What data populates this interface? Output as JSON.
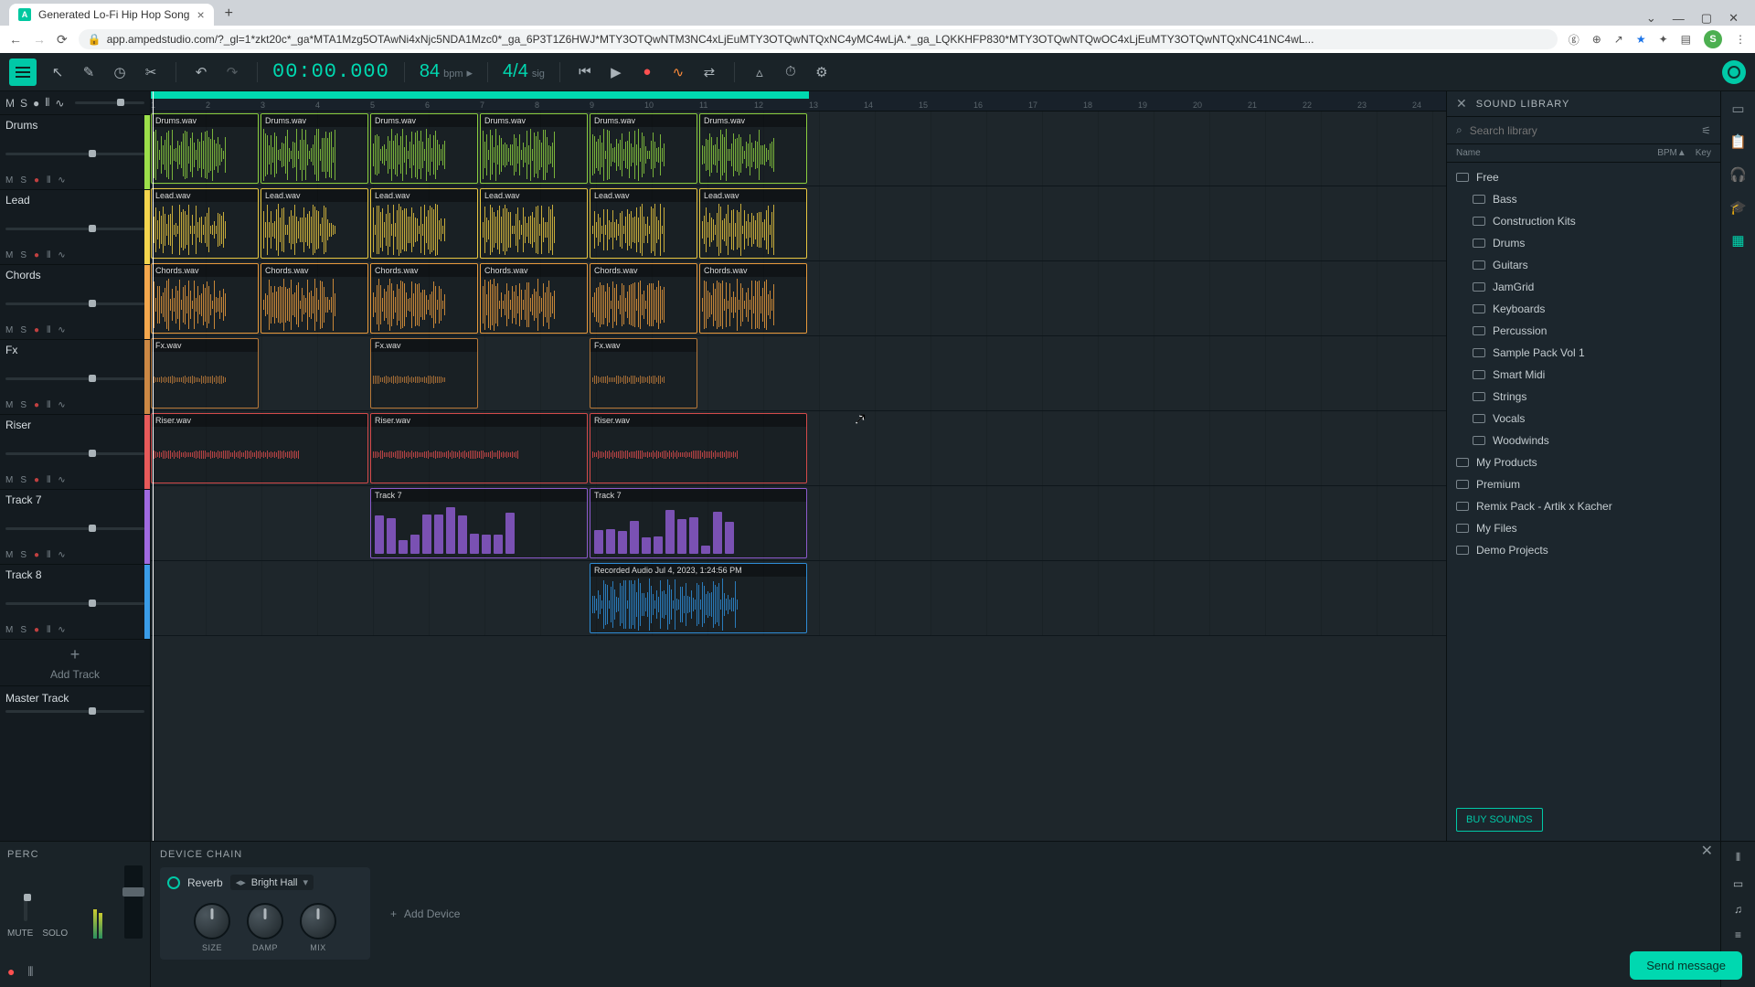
{
  "browser": {
    "tab_title": "Generated Lo-Fi Hip Hop Song",
    "url": "app.ampedstudio.com/?_gl=1*zkt20c*_ga*MTA1Mzg5OTAwNi4xNjc5NDA1Mzc0*_ga_6P3T1Z6HWJ*MTY3OTQwNTM3NC4xLjEuMTY3OTQwNTQxNC4yMC4wLjA.*_ga_LQKKHFP830*MTY3OTQwNTQwOC4xLjEuMTY3OTQwNTQxNC41NC4wL..."
  },
  "transport": {
    "time": "00:00.000",
    "bpm": "84",
    "bpm_label": "bpm",
    "sig": "4/4",
    "sig_label": "sig"
  },
  "ruler_ticks": [
    "1",
    "2",
    "3",
    "4",
    "5",
    "6",
    "7",
    "8",
    "9",
    "10",
    "11",
    "12",
    "13",
    "14",
    "15",
    "16",
    "17",
    "18",
    "19",
    "20",
    "21",
    "22",
    "23",
    "24"
  ],
  "tracks": [
    {
      "name": "Drums",
      "color": "#9ce04a",
      "clip_color": "#8bce3f",
      "clips": [
        {
          "label": "Drums.wav",
          "start": 0,
          "len": 2
        },
        {
          "label": "Drums.wav",
          "start": 2,
          "len": 2
        },
        {
          "label": "Drums.wav",
          "start": 4,
          "len": 2
        },
        {
          "label": "Drums.wav",
          "start": 6,
          "len": 2
        },
        {
          "label": "Drums.wav",
          "start": 8,
          "len": 2
        },
        {
          "label": "Drums.wav",
          "start": 10,
          "len": 2
        }
      ]
    },
    {
      "name": "Lead",
      "color": "#f5d54d",
      "clip_color": "#e8c640",
      "clips": [
        {
          "label": "Lead.wav",
          "start": 0,
          "len": 2
        },
        {
          "label": "Lead.wav",
          "start": 2,
          "len": 2
        },
        {
          "label": "Lead.wav",
          "start": 4,
          "len": 2
        },
        {
          "label": "Lead.wav",
          "start": 6,
          "len": 2
        },
        {
          "label": "Lead.wav",
          "start": 8,
          "len": 2
        },
        {
          "label": "Lead.wav",
          "start": 10,
          "len": 2
        }
      ]
    },
    {
      "name": "Chords",
      "color": "#f5a84d",
      "clip_color": "#e89a3c",
      "clips": [
        {
          "label": "Chords.wav",
          "start": 0,
          "len": 2
        },
        {
          "label": "Chords.wav",
          "start": 2,
          "len": 2
        },
        {
          "label": "Chords.wav",
          "start": 4,
          "len": 2
        },
        {
          "label": "Chords.wav",
          "start": 6,
          "len": 2
        },
        {
          "label": "Chords.wav",
          "start": 8,
          "len": 2
        },
        {
          "label": "Chords.wav",
          "start": 10,
          "len": 2
        }
      ]
    },
    {
      "name": "Fx",
      "color": "#cc8844",
      "clip_color": "#b87838",
      "thin": true,
      "clips": [
        {
          "label": "Fx.wav",
          "start": 0,
          "len": 2
        },
        {
          "label": "Fx.wav",
          "start": 4,
          "len": 2
        },
        {
          "label": "Fx.wav",
          "start": 8,
          "len": 2
        }
      ]
    },
    {
      "name": "Riser",
      "color": "#e85a5a",
      "clip_color": "#d44a4a",
      "thin": true,
      "clips": [
        {
          "label": "Riser.wav",
          "start": 0,
          "len": 4
        },
        {
          "label": "Riser.wav",
          "start": 4,
          "len": 4
        },
        {
          "label": "Riser.wav",
          "start": 8,
          "len": 4
        }
      ]
    },
    {
      "name": "Track 7",
      "color": "#a06ae0",
      "clip_color": "#8c5acc",
      "midi": true,
      "clips": [
        {
          "label": "Track 7",
          "start": 4,
          "len": 4
        },
        {
          "label": "Track 7",
          "start": 8,
          "len": 4
        }
      ]
    },
    {
      "name": "Track 8",
      "color": "#3a9ce8",
      "clip_color": "#2e8cd6",
      "clips": [
        {
          "label": "Recorded Audio Jul 4, 2023, 1:24:56 PM",
          "start": 8,
          "len": 4
        }
      ]
    }
  ],
  "track_buttons": {
    "mute": "M",
    "solo": "S",
    "record_icon": "●"
  },
  "add_track_label": "Add Track",
  "master_track_label": "Master Track",
  "library": {
    "title": "SOUND LIBRARY",
    "search_placeholder": "Search library",
    "cols": {
      "name": "Name",
      "bpm": "BPM▲",
      "key": "Key"
    },
    "items": [
      {
        "label": "Free",
        "sub": false
      },
      {
        "label": "Bass",
        "sub": true
      },
      {
        "label": "Construction Kits",
        "sub": true
      },
      {
        "label": "Drums",
        "sub": true
      },
      {
        "label": "Guitars",
        "sub": true
      },
      {
        "label": "JamGrid",
        "sub": true
      },
      {
        "label": "Keyboards",
        "sub": true
      },
      {
        "label": "Percussion",
        "sub": true
      },
      {
        "label": "Sample Pack Vol 1",
        "sub": true
      },
      {
        "label": "Smart Midi",
        "sub": true
      },
      {
        "label": "Strings",
        "sub": true
      },
      {
        "label": "Vocals",
        "sub": true
      },
      {
        "label": "Woodwinds",
        "sub": true
      },
      {
        "label": "My Products",
        "sub": false
      },
      {
        "label": "Premium",
        "sub": false
      },
      {
        "label": "Remix Pack - Artik x Kacher",
        "sub": false
      },
      {
        "label": "My Files",
        "sub": false
      },
      {
        "label": "Demo Projects",
        "sub": false
      }
    ],
    "buy_label": "BUY SOUNDS"
  },
  "device_panel": {
    "left_title": "PERC",
    "mute": "MUTE",
    "solo": "SOLO",
    "chain_title": "DEVICE CHAIN",
    "device_name": "Reverb",
    "preset": "Bright Hall",
    "knobs": [
      "SIZE",
      "DAMP",
      "MIX"
    ],
    "add_device": "Add Device"
  },
  "chat_label": "Send message"
}
